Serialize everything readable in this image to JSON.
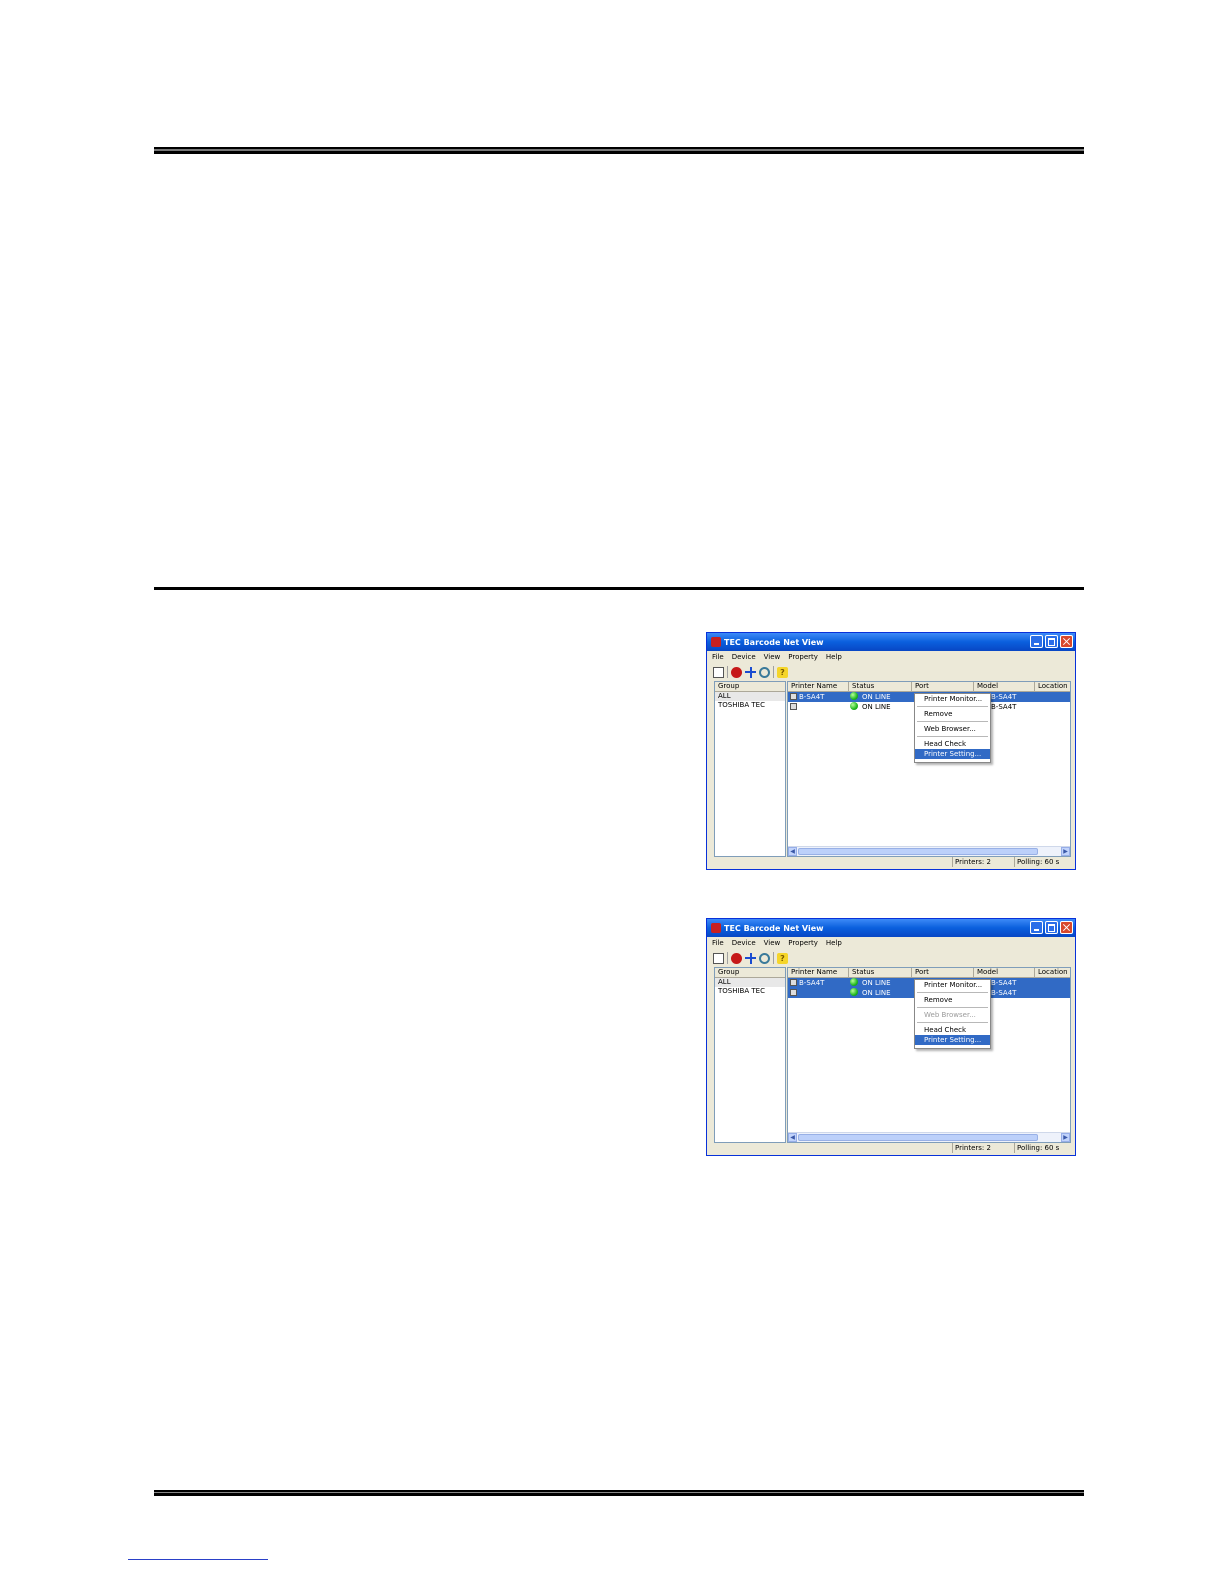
{
  "windows": [
    {
      "title": "TEC Barcode Net View",
      "menu": [
        "File",
        "Device",
        "View",
        "Property",
        "Help"
      ],
      "group_header": "Group",
      "groups": [
        "ALL",
        "TOSHIBA TEC"
      ],
      "columns": [
        "Printer Name",
        "Status",
        "Port",
        "Model",
        "Location"
      ],
      "rows": [
        {
          "name": "B-SA4T",
          "status": "ON LINE",
          "model": "B-SA4T",
          "selected": true
        },
        {
          "name": "",
          "status": "ON LINE",
          "model": "B-SA4T",
          "selected": false
        }
      ],
      "context_menu": {
        "items": [
          "Printer Monitor...",
          "Remove",
          "Web Browser...",
          "Head Check",
          "Printer Setting..."
        ],
        "web_browser_disabled": false,
        "highlighted": "Printer Setting..."
      },
      "status_bar": {
        "printers": "Printers: 2",
        "polling": "Polling: 60 s"
      }
    },
    {
      "title": "TEC Barcode Net View",
      "menu": [
        "File",
        "Device",
        "View",
        "Property",
        "Help"
      ],
      "group_header": "Group",
      "groups": [
        "ALL",
        "TOSHIBA TEC"
      ],
      "columns": [
        "Printer Name",
        "Status",
        "Port",
        "Model",
        "Location"
      ],
      "rows": [
        {
          "name": "B-SA4T",
          "status": "ON LINE",
          "model": "B-SA4T",
          "selected": true
        },
        {
          "name": "",
          "status": "ON LINE",
          "model": "B-SA4T",
          "selected": true
        }
      ],
      "context_menu": {
        "items": [
          "Printer Monitor...",
          "Remove",
          "Web Browser...",
          "Head Check",
          "Printer Setting..."
        ],
        "web_browser_disabled": true,
        "highlighted": "Printer Setting..."
      },
      "status_bar": {
        "printers": "Printers: 2",
        "polling": "Polling: 60 s"
      }
    }
  ],
  "colors": {
    "selection": "#316ac5",
    "titlebar": "#0a5fdd",
    "status_online": "#1fb81f"
  }
}
